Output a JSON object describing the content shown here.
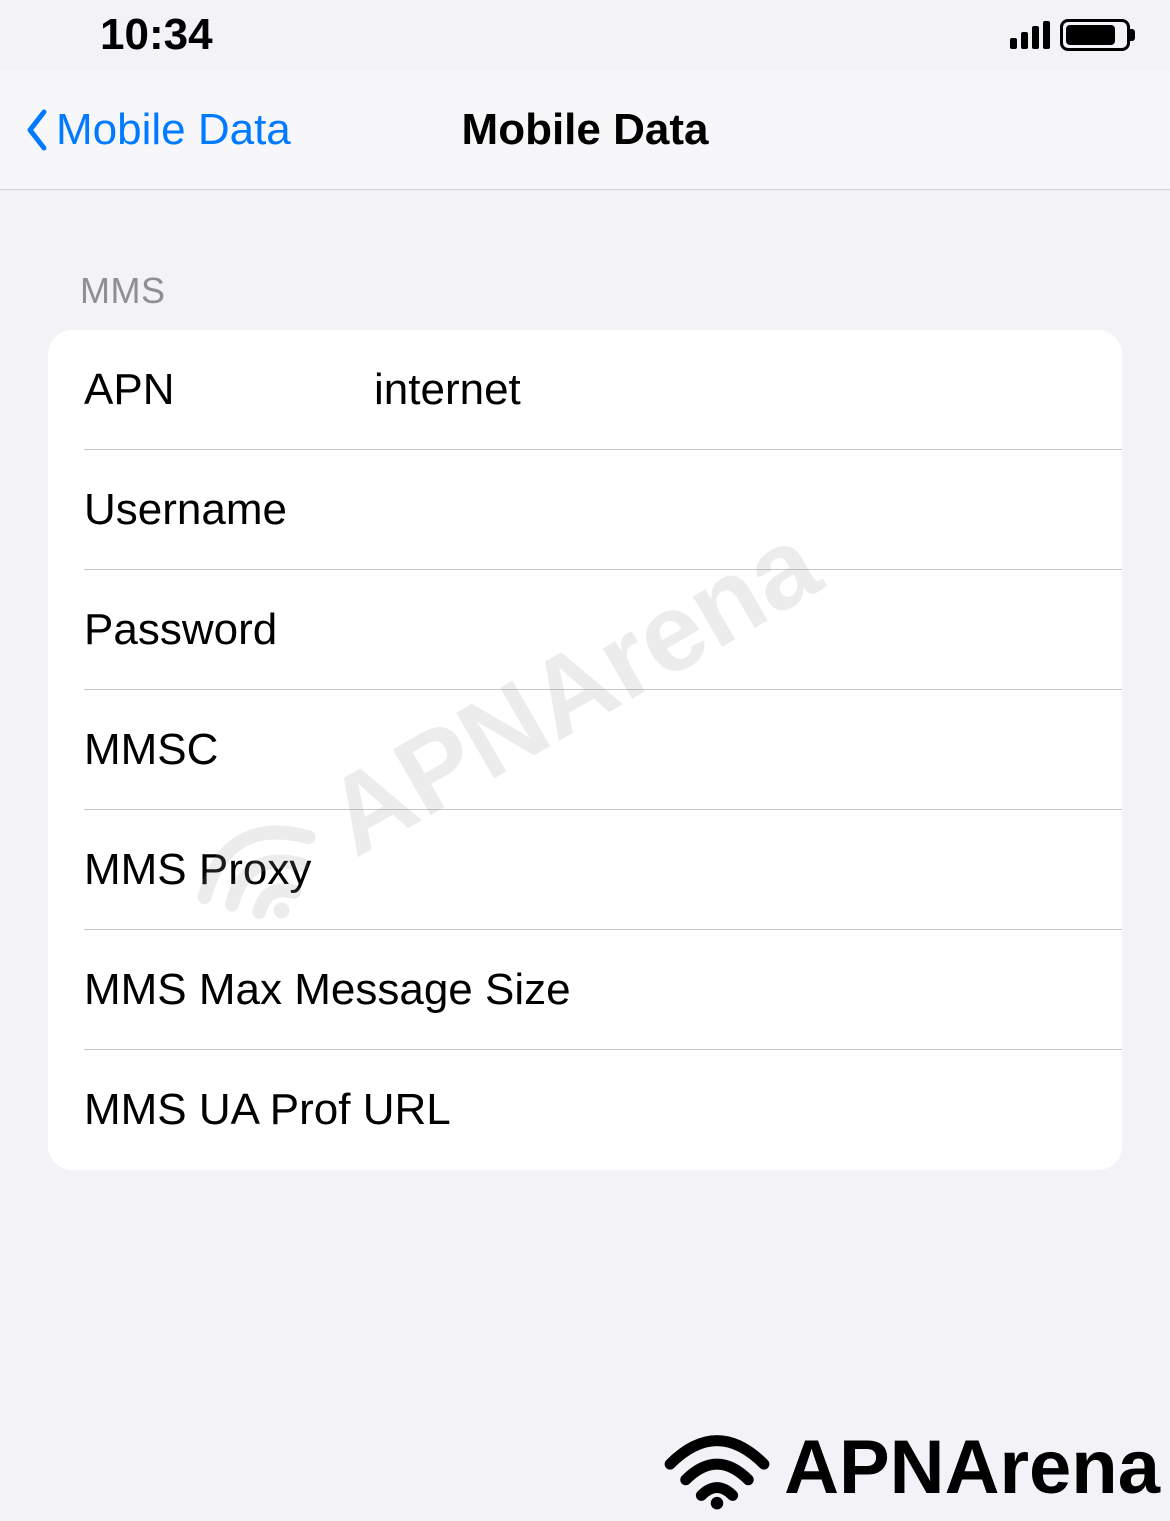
{
  "statusBar": {
    "time": "10:34"
  },
  "navBar": {
    "backLabel": "Mobile Data",
    "title": "Mobile Data"
  },
  "section": {
    "header": "MMS"
  },
  "rows": {
    "apn": {
      "label": "APN",
      "value": "internet"
    },
    "username": {
      "label": "Username",
      "value": ""
    },
    "password": {
      "label": "Password",
      "value": ""
    },
    "mmsc": {
      "label": "MMSC",
      "value": ""
    },
    "mmsProxy": {
      "label": "MMS Proxy",
      "value": ""
    },
    "mmsMaxSize": {
      "label": "MMS Max Message Size",
      "value": ""
    },
    "mmsUaProf": {
      "label": "MMS UA Prof URL",
      "value": ""
    }
  },
  "watermark": {
    "text": "APNArena"
  }
}
